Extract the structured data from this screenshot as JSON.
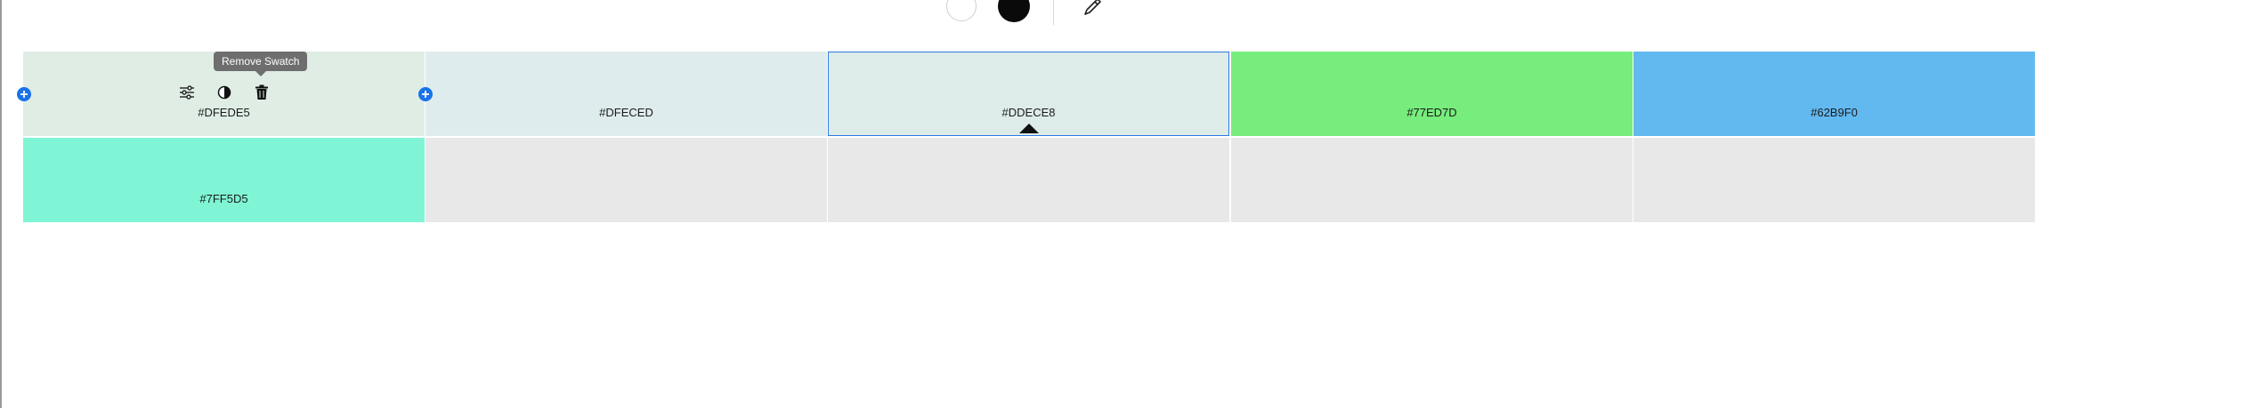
{
  "toolbar": {
    "white_circle_icon": "white-swatch-icon",
    "black_circle_icon": "black-swatch-icon",
    "eyedropper_icon": "eyedropper-icon"
  },
  "tooltip": {
    "text": "Remove Swatch"
  },
  "colors": {
    "accent": "#2f7ae5",
    "add_button": "#1a73e8",
    "empty_slot": "#e8e8e8"
  },
  "swatches": [
    {
      "hex": "#DFEDE5",
      "color": "#DFEDE5"
    },
    {
      "hex": "#DFECED",
      "color": "#DFECED"
    },
    {
      "hex": "#DDECE8",
      "color": "#DDECE8"
    },
    {
      "hex": "#77ED7D",
      "color": "#77ED7D"
    },
    {
      "hex": "#62B9F0",
      "color": "#62B9F0"
    },
    {
      "hex": "#7FF5D5",
      "color": "#7FF5D5"
    }
  ],
  "swatch_tools": [
    "sliders-icon",
    "contrast-icon",
    "trash-icon"
  ]
}
